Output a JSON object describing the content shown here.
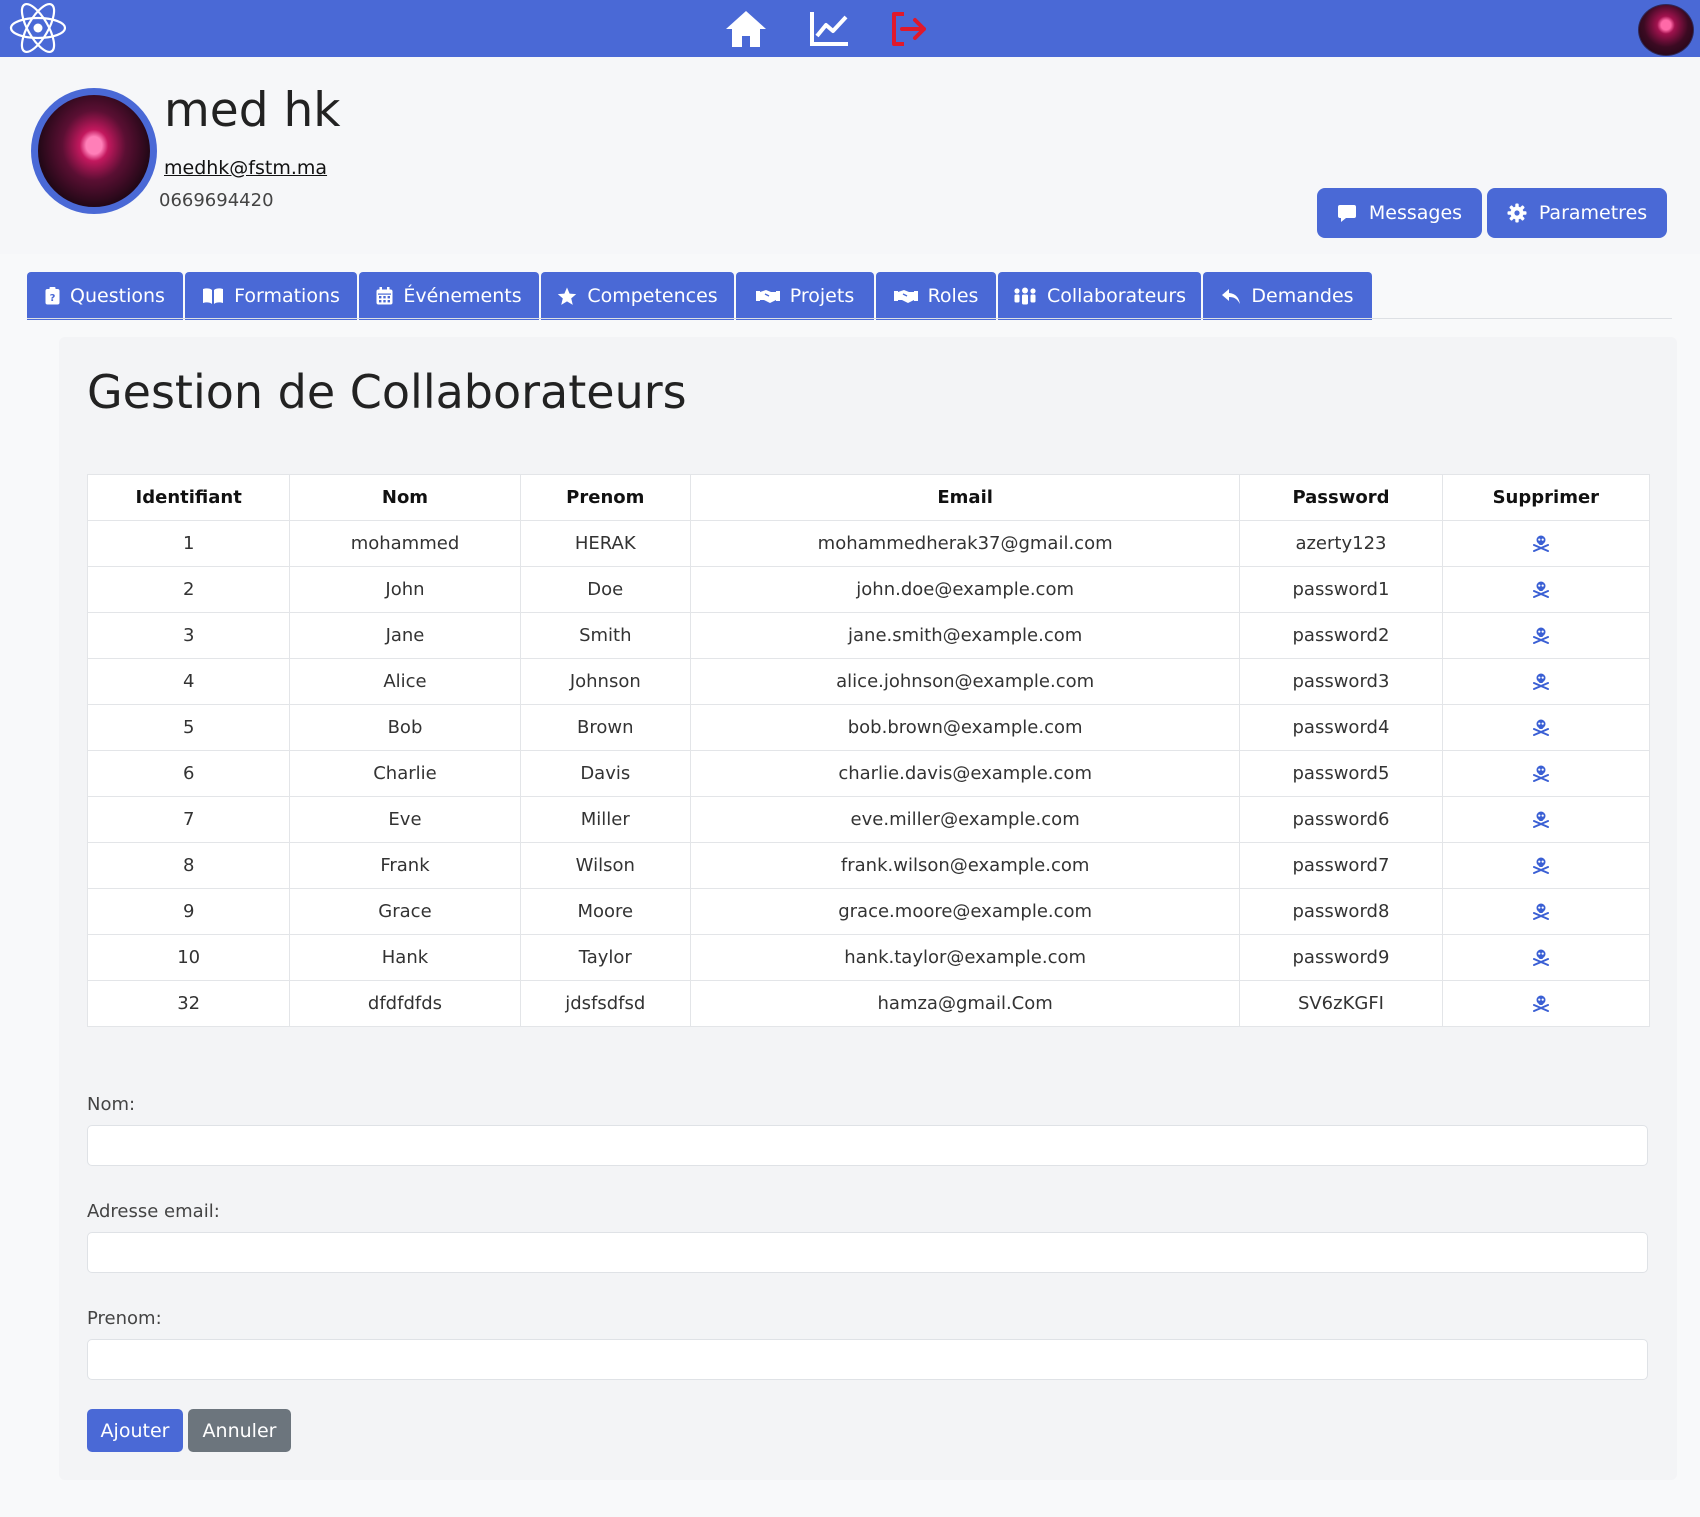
{
  "profile": {
    "name": "med hk",
    "email": "medhk@fstm.ma",
    "phone": "0669694420"
  },
  "actions": {
    "messages": "Messages",
    "settings": "Parametres"
  },
  "tabs": [
    "Questions",
    "Formations",
    "Événements",
    "Competences",
    "Projets",
    "Roles",
    "Collaborateurs",
    "Demandes"
  ],
  "page": {
    "title": "Gestion de Collaborateurs"
  },
  "table": {
    "headers": [
      "Identifiant",
      "Nom",
      "Prenom",
      "Email",
      "Password",
      "Supprimer"
    ],
    "rows": [
      [
        "1",
        "mohammed",
        "HERAK",
        "mohammedherak37@gmail.com",
        "azerty123"
      ],
      [
        "2",
        "John",
        "Doe",
        "john.doe@example.com",
        "password1"
      ],
      [
        "3",
        "Jane",
        "Smith",
        "jane.smith@example.com",
        "password2"
      ],
      [
        "4",
        "Alice",
        "Johnson",
        "alice.johnson@example.com",
        "password3"
      ],
      [
        "5",
        "Bob",
        "Brown",
        "bob.brown@example.com",
        "password4"
      ],
      [
        "6",
        "Charlie",
        "Davis",
        "charlie.davis@example.com",
        "password5"
      ],
      [
        "7",
        "Eve",
        "Miller",
        "eve.miller@example.com",
        "password6"
      ],
      [
        "8",
        "Frank",
        "Wilson",
        "frank.wilson@example.com",
        "password7"
      ],
      [
        "9",
        "Grace",
        "Moore",
        "grace.moore@example.com",
        "password8"
      ],
      [
        "10",
        "Hank",
        "Taylor",
        "hank.taylor@example.com",
        "password9"
      ],
      [
        "32",
        "dfdfdfds",
        "jdsfsdfsd",
        "hamza@gmail.Com",
        "SV6zKGFI"
      ]
    ],
    "delete_icon": "skull-crossbones-icon"
  },
  "form": {
    "nom_label": "Nom:",
    "nom_value": "",
    "email_label": "Adresse email:",
    "email_value": "",
    "prenom_label": "Prenom:",
    "prenom_value": "",
    "submit": "Ajouter",
    "cancel": "Annuler"
  },
  "colors": {
    "primary": "#4a69d6",
    "logout": "#e0192b",
    "secondary": "#6c757d"
  }
}
